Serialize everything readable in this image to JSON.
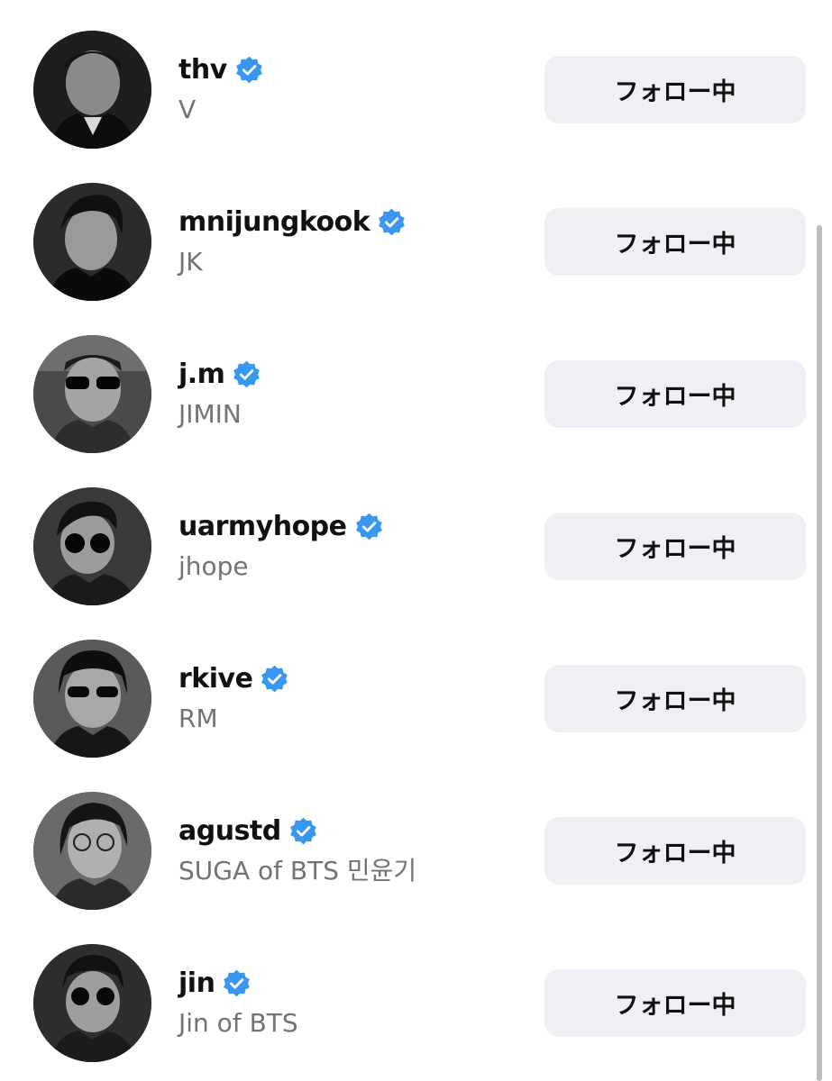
{
  "follow_label": "フォロー中",
  "accent_color": "#3897f0",
  "following_list": [
    {
      "username": "thv",
      "full_name": "V",
      "verified": true
    },
    {
      "username": "mnijungkook",
      "full_name": "JK",
      "verified": true
    },
    {
      "username": "j.m",
      "full_name": "JIMIN",
      "verified": true
    },
    {
      "username": "uarmyhope",
      "full_name": "jhope",
      "verified": true
    },
    {
      "username": "rkive",
      "full_name": "RM",
      "verified": true
    },
    {
      "username": "agustd",
      "full_name": "SUGA of BTS 민윤기",
      "verified": true
    },
    {
      "username": "jin",
      "full_name": "Jin of BTS",
      "verified": true
    }
  ]
}
